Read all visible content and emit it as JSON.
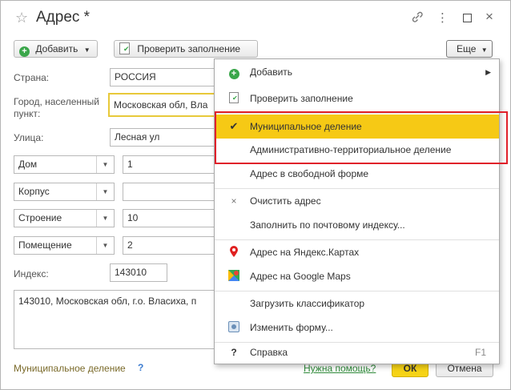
{
  "window": {
    "title": "Адрес *"
  },
  "toolbar": {
    "add_label": "Добавить",
    "check_label": "Проверить заполнение",
    "more_label": "Еще"
  },
  "form": {
    "country_label": "Страна:",
    "country_value": "РОССИЯ",
    "city_label": "Город, населенный пункт:",
    "city_value": "Московская обл, Вла",
    "street_label": "Улица:",
    "street_value": "Лесная ул",
    "house_type": "Дом",
    "house_value": "1",
    "korpus_type": "Корпус",
    "korpus_value": "",
    "stroenie_type": "Строение",
    "stroenie_value": "10",
    "room_type": "Помещение",
    "room_value": "2",
    "index_label": "Индекс:",
    "index_value": "143010",
    "address_text": "143010, Московская обл, г.о. Власиха, п",
    "municipal_link": "Муниципальное деление",
    "help_mark": "?"
  },
  "footer": {
    "help_link": "Нужна помощь?",
    "ok_label": "ОК",
    "cancel_label": "Отмена"
  },
  "menu": {
    "items": [
      {
        "label": "Добавить",
        "icon": "plus-circle-icon"
      },
      {
        "label": "Проверить заполнение",
        "icon": "check-document-icon"
      },
      {
        "label": "Муниципальное деление",
        "icon": "checkmark-icon"
      },
      {
        "label": "Административно-территориальное деление",
        "icon": ""
      },
      {
        "label": "Адрес в свободной форме",
        "icon": ""
      },
      {
        "label": "Очистить адрес",
        "icon": "clear-x-icon"
      },
      {
        "label": "Заполнить по почтовому индексу...",
        "icon": ""
      },
      {
        "label": "Адрес на Яндекс.Картах",
        "icon": "yandex-pin-icon"
      },
      {
        "label": "Адрес на Google Maps",
        "icon": "google-maps-icon"
      },
      {
        "label": "Загрузить классификатор",
        "icon": ""
      },
      {
        "label": "Изменить форму...",
        "icon": "form-settings-icon"
      },
      {
        "label": "Справка",
        "icon": "help-icon"
      }
    ],
    "help_shortcut": "F1"
  },
  "colors": {
    "highlight": "#f6c915",
    "red_box": "#e0202a",
    "ok_button": "#f6d316",
    "link_green": "#2f8a3a"
  }
}
